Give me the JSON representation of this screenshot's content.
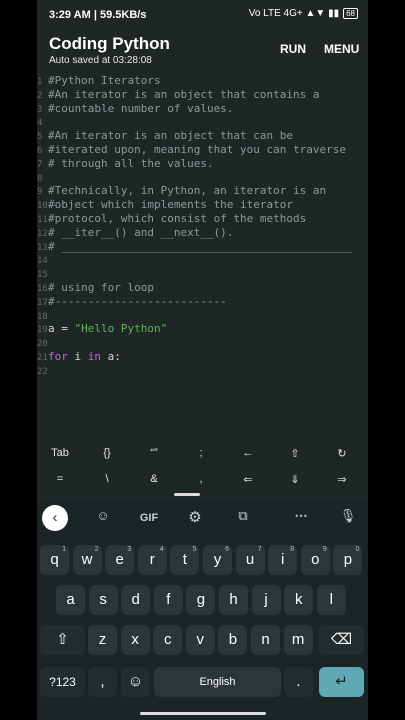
{
  "status": {
    "time": "3:29 AM | 59.5KB/s",
    "right": "Vo LTE 4G+ ▲▼ ▮▮",
    "battery": "68"
  },
  "header": {
    "title": "Coding Python",
    "subtitle": "Auto saved at 03:28:08",
    "run": "RUN",
    "menu": "MENU"
  },
  "code": [
    {
      "n": "1",
      "t": "#Python Iterators",
      "c": "comment"
    },
    {
      "n": "2",
      "t": "#An iterator is an object that contains a",
      "c": "comment"
    },
    {
      "n": "3",
      "t": "#countable number of values.",
      "c": "comment"
    },
    {
      "n": "4",
      "t": "",
      "c": "comment"
    },
    {
      "n": "5",
      "t": "#An iterator is an object that can be",
      "c": "comment"
    },
    {
      "n": "6",
      "t": "#iterated upon, meaning that you can traverse",
      "c": "comment"
    },
    {
      "n": "7",
      "t": "# through all the values.",
      "c": "comment"
    },
    {
      "n": "8",
      "t": "",
      "c": "comment"
    },
    {
      "n": "9",
      "t": "#Technically, in Python, an iterator is an",
      "c": "comment"
    },
    {
      "n": "10",
      "t": "#object which implements the iterator",
      "c": "comment"
    },
    {
      "n": "11",
      "t": "#protocol, which consist of the methods",
      "c": "comment"
    },
    {
      "n": "12",
      "t": "# __iter__() and __next__().",
      "c": "comment"
    },
    {
      "n": "13",
      "t": "# ____________________________________________",
      "c": "comment"
    },
    {
      "n": "14",
      "t": "",
      "c": "comment"
    },
    {
      "n": "15",
      "t": "",
      "c": "comment"
    },
    {
      "n": "16",
      "t": "# using for loop",
      "c": "comment"
    },
    {
      "n": "17",
      "t": "#--------------------------",
      "c": "comment"
    },
    {
      "n": "18",
      "t": "",
      "c": "comment"
    },
    {
      "n": "19",
      "t": "",
      "c": "plain"
    },
    {
      "n": "20",
      "t": "",
      "c": "comment"
    },
    {
      "n": "21",
      "t": "",
      "c": "plain"
    },
    {
      "n": "22",
      "t": "",
      "c": "comment"
    }
  ],
  "line19": {
    "a": "a = ",
    "s": "\"Hello Python\""
  },
  "line21": {
    "k1": "for",
    "m": " i ",
    "k2": "in",
    "e": " a:"
  },
  "extra_keys": [
    "Tab",
    "{}",
    "“”",
    ";",
    "←",
    "⇧",
    "↻",
    "=",
    "\\",
    "&",
    ",",
    "⇐",
    "⇓",
    "⇒"
  ],
  "toolbar": [
    "GIF",
    "⚙",
    "⋯"
  ],
  "keyboard": {
    "row1": [
      "q",
      "w",
      "e",
      "r",
      "t",
      "y",
      "u",
      "i",
      "o",
      "p"
    ],
    "row1_num": [
      "1",
      "2",
      "3",
      "4",
      "5",
      "6",
      "7",
      "8",
      "9",
      "0"
    ],
    "row2": [
      "a",
      "s",
      "d",
      "f",
      "g",
      "h",
      "j",
      "k",
      "l"
    ],
    "row3": [
      "z",
      "x",
      "c",
      "v",
      "b",
      "n",
      "m"
    ],
    "num_key": "?123",
    "comma": ",",
    "space": "English",
    "period": "."
  }
}
